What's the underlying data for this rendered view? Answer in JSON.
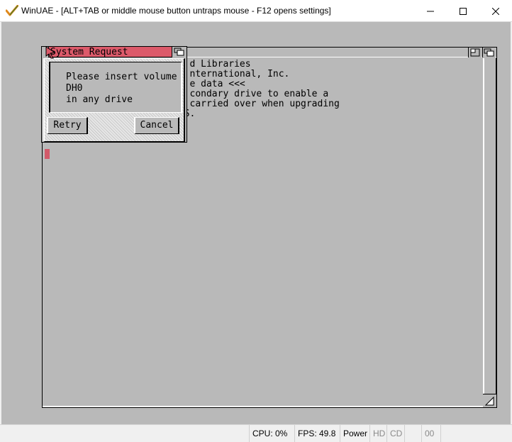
{
  "window": {
    "title": "WinUAE - [ALT+TAB or middle mouse button untraps mouse - F12 opens settings]",
    "controls": [
      "minimize-icon",
      "maximize-icon",
      "close-icon"
    ]
  },
  "shell": {
    "lines": [
      "                          d Libraries",
      "                          nternational, Inc.",
      "",
      "",
      "                          e data <<<",
      "",
      "                          condary drive to enable a",
      "                          carried over when upgrading",
      "to new releases of MegaMOS."
    ]
  },
  "requester": {
    "title": "System Request",
    "message": [
      "Please insert volume",
      "DH0",
      "in any drive"
    ],
    "retry_label": "Retry",
    "cancel_label": "Cancel"
  },
  "statusbar": {
    "cpu": "CPU: 0%",
    "fps": "FPS: 49.8",
    "power": "Power",
    "hd": "HD",
    "cd": "CD",
    "drive": "00"
  },
  "colors": {
    "amiga_gray": "#b9b9b9",
    "requester_title": "#dc5a6a",
    "cursor": "#d25a6a",
    "app_icon_check": "#e08a1e"
  }
}
